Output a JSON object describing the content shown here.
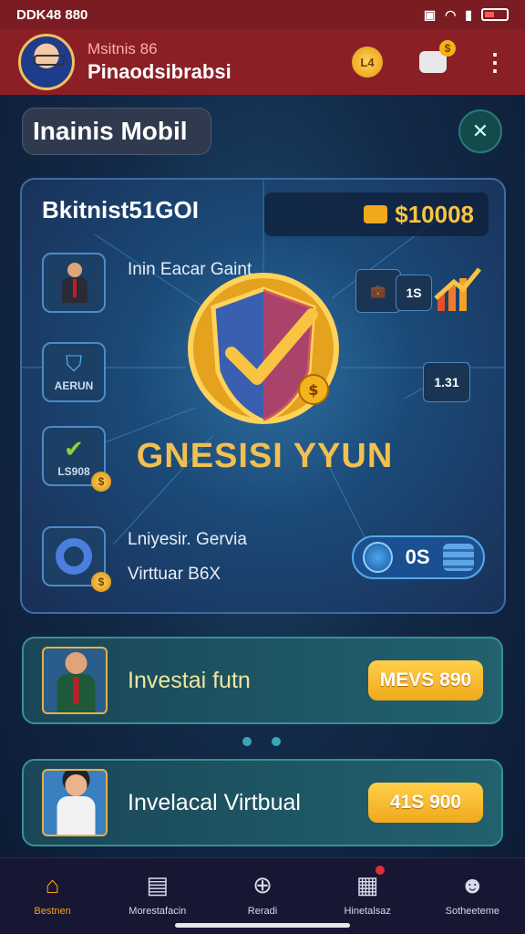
{
  "status_bar": {
    "time": "DDK48 880"
  },
  "header": {
    "subtitle": "Msitnis 86",
    "name": "Pinaodsibrabsi",
    "search_coin_label": "L4"
  },
  "page_title": "Inainis Mobil",
  "main_card": {
    "title": "Bkitnist51GOI",
    "balance": "$10008",
    "row1_text": "Inin Eacar Gaint",
    "tile2_label": "AERUN",
    "tile3_label": "LS908",
    "row4_line1": "Lniyesir. Gervia",
    "row4_line2": "Virttuar B6X",
    "emblem_label": "GNESISI YYUN",
    "badge_top": "1S",
    "badge_mid": "1.31",
    "toggle_value": "0S"
  },
  "invest_cards": [
    {
      "label": "Investai futn",
      "button": "MEVS 890"
    },
    {
      "label": "Invelacal Virtbual",
      "button": "41S 900"
    }
  ],
  "bottom_nav": [
    {
      "label": "Bestnen",
      "active": true
    },
    {
      "label": "Morestafacin",
      "active": false
    },
    {
      "label": "Reradi",
      "active": false
    },
    {
      "label": "Hinetalsaz",
      "active": false
    },
    {
      "label": "Sotheeteme",
      "active": false
    }
  ],
  "colors": {
    "header": "#8b1f26",
    "accent_gold": "#f6c445",
    "nav_active": "#f6a21b"
  },
  "icons": [
    "wifi-icon",
    "battery-icon",
    "search-coin-icon",
    "chat-coin-icon",
    "more-icon",
    "close-icon",
    "home-icon",
    "document-icon",
    "plus-circle-icon",
    "inbox-icon",
    "profile-icon"
  ]
}
